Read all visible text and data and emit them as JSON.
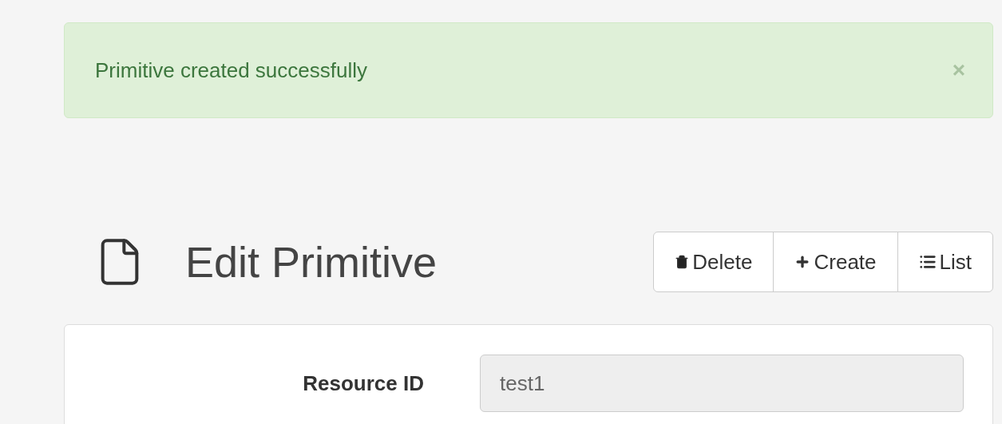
{
  "alert": {
    "message": "Primitive created successfully",
    "close": "×"
  },
  "header": {
    "title": "Edit Primitive"
  },
  "actions": [
    {
      "kind": "delete",
      "label": "Delete"
    },
    {
      "kind": "create",
      "label": "Create"
    },
    {
      "kind": "list",
      "label": "List"
    }
  ],
  "form": {
    "fields": [
      {
        "label": "Resource ID",
        "value": "test1",
        "disabled": true
      }
    ]
  }
}
